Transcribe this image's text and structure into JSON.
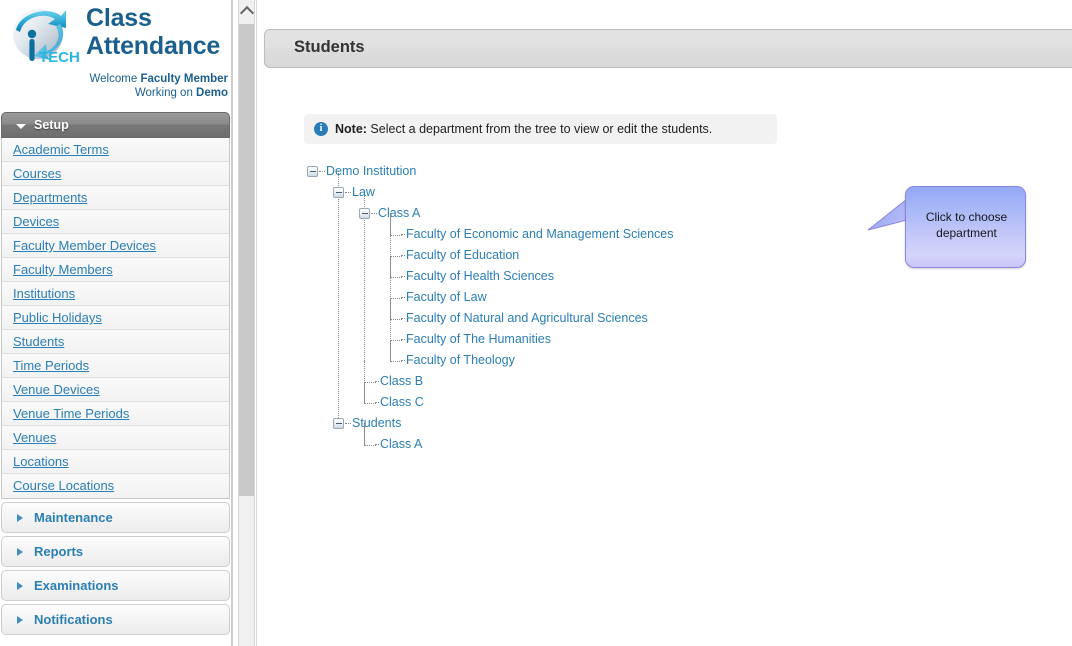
{
  "brand": {
    "logo_icon": "iptech-globe-logo",
    "title_line1": "Class",
    "title_line2": "Attendance",
    "welcome_prefix": "Welcome ",
    "welcome_name": "Faculty Member",
    "working_prefix": "Working on ",
    "working_name": "Demo"
  },
  "sidebar": {
    "setup": {
      "label": "Setup",
      "expanded": true,
      "items": [
        {
          "label": "Academic Terms"
        },
        {
          "label": "Courses"
        },
        {
          "label": "Departments"
        },
        {
          "label": "Devices"
        },
        {
          "label": "Faculty Member Devices"
        },
        {
          "label": "Faculty Members"
        },
        {
          "label": "Institutions"
        },
        {
          "label": "Public Holidays"
        },
        {
          "label": "Students"
        },
        {
          "label": "Time Periods"
        },
        {
          "label": "Venue Devices"
        },
        {
          "label": "Venue Time Periods"
        },
        {
          "label": "Venues"
        },
        {
          "label": "Locations"
        },
        {
          "label": "Course Locations"
        }
      ]
    },
    "sections": [
      {
        "label": "Maintenance"
      },
      {
        "label": "Reports"
      },
      {
        "label": "Examinations"
      },
      {
        "label": "Notifications"
      }
    ]
  },
  "scrollbar": {
    "up_arrow_icon": "chevron-up-icon"
  },
  "main": {
    "page_title": "Students",
    "note": {
      "icon": "info-icon",
      "icon_glyph": "i",
      "label": "Note:",
      "text": " Select a department from the tree to view or edit the students."
    }
  },
  "tree": {
    "nodes": [
      {
        "id": "demo-institution",
        "label": "Demo Institution",
        "depth": 0,
        "type": "branch",
        "expanded": true
      },
      {
        "id": "law",
        "label": "Law",
        "depth": 1,
        "type": "branch",
        "expanded": true
      },
      {
        "id": "law-class-a",
        "label": "Class A",
        "depth": 2,
        "type": "branch",
        "expanded": true
      },
      {
        "id": "fac-ems",
        "label": "Faculty of Economic and Management Sciences",
        "depth": 3,
        "type": "leaf"
      },
      {
        "id": "fac-edu",
        "label": "Faculty of Education",
        "depth": 3,
        "type": "leaf"
      },
      {
        "id": "fac-health",
        "label": "Faculty of Health Sciences",
        "depth": 3,
        "type": "leaf"
      },
      {
        "id": "fac-law",
        "label": "Faculty of Law",
        "depth": 3,
        "type": "leaf"
      },
      {
        "id": "fac-nat-agri",
        "label": "Faculty of Natural and Agricultural Sciences",
        "depth": 3,
        "type": "leaf"
      },
      {
        "id": "fac-humanities",
        "label": "Faculty of The Humanities",
        "depth": 3,
        "type": "leaf"
      },
      {
        "id": "fac-theology",
        "label": "Faculty of Theology",
        "depth": 3,
        "type": "leaf",
        "last": true
      },
      {
        "id": "law-class-b",
        "label": "Class B",
        "depth": 2,
        "type": "leaf"
      },
      {
        "id": "law-class-c",
        "label": "Class C",
        "depth": 2,
        "type": "leaf",
        "last": true
      },
      {
        "id": "students",
        "label": "Students",
        "depth": 1,
        "type": "branch",
        "expanded": true,
        "last": true
      },
      {
        "id": "students-class-a",
        "label": "Class A",
        "depth": 2,
        "type": "leaf",
        "last": true
      }
    ]
  },
  "callout": {
    "text": "Click to choose department",
    "fill_top": "#93a8f4",
    "fill_bottom": "#c8c6f6",
    "border": "#8b86e0"
  },
  "colors": {
    "link": "#2b7fb5",
    "brand": "#1b5f8e",
    "header_bar": "#e0e0e0",
    "note_bg": "#f2f2f2"
  }
}
